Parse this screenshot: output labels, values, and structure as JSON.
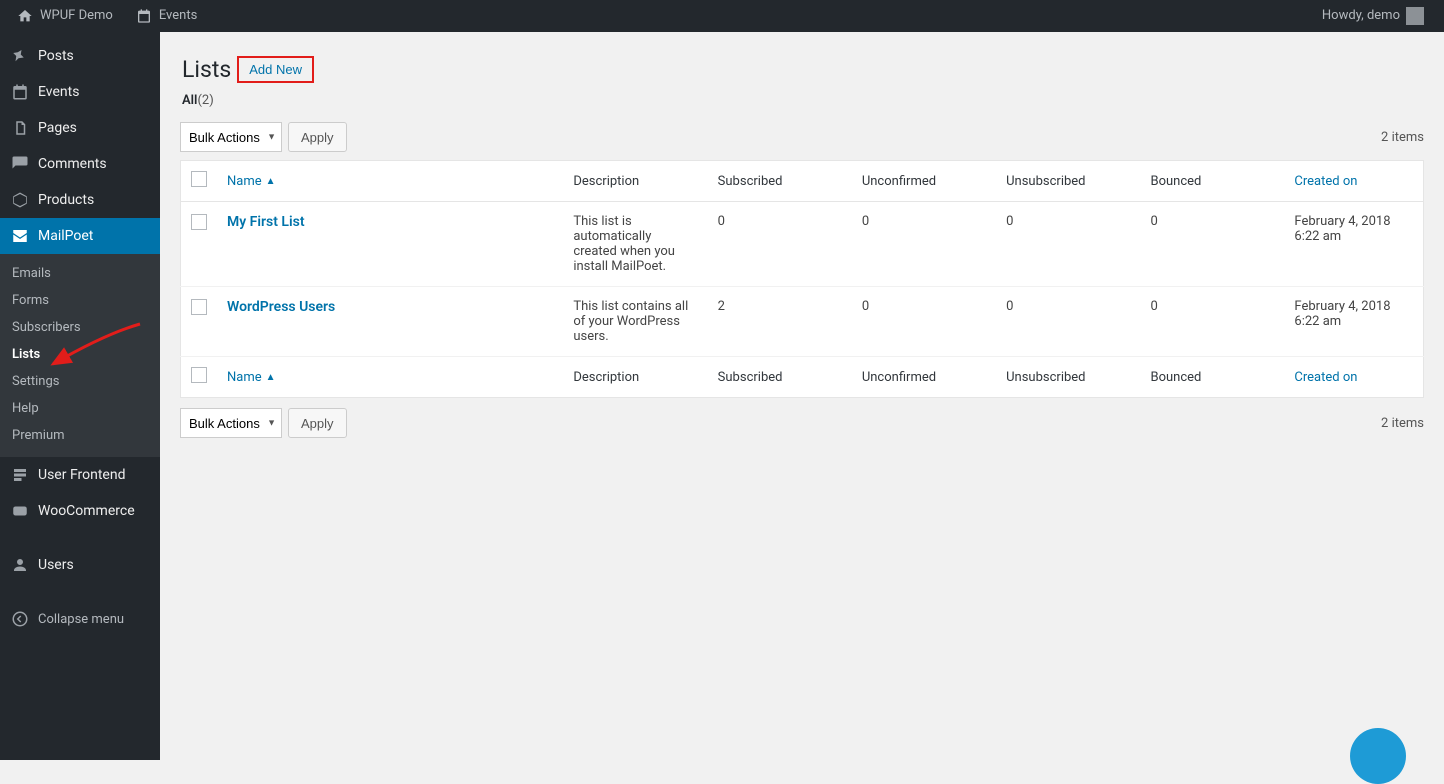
{
  "adminbar": {
    "site_name": "WPUF Demo",
    "events_label": "Events",
    "howdy": "Howdy, demo"
  },
  "sidebar": {
    "items": [
      {
        "label": "Posts"
      },
      {
        "label": "Events"
      },
      {
        "label": "Pages"
      },
      {
        "label": "Comments"
      },
      {
        "label": "Products"
      },
      {
        "label": "MailPoet"
      },
      {
        "label": "User Frontend"
      },
      {
        "label": "WooCommerce"
      },
      {
        "label": "Users"
      }
    ],
    "mailpoet_sub": [
      {
        "label": "Emails"
      },
      {
        "label": "Forms"
      },
      {
        "label": "Subscribers"
      },
      {
        "label": "Lists"
      },
      {
        "label": "Settings"
      },
      {
        "label": "Help"
      },
      {
        "label": "Premium"
      }
    ],
    "collapse_label": "Collapse menu"
  },
  "page": {
    "title": "Lists",
    "add_new_label": "Add New",
    "filter_all_label": "All",
    "filter_all_count": "(2)",
    "bulk_actions_label": "Bulk Actions",
    "apply_label": "Apply",
    "items_count_label": "2 items"
  },
  "columns": {
    "name": "Name",
    "description": "Description",
    "subscribed": "Subscribed",
    "unconfirmed": "Unconfirmed",
    "unsubscribed": "Unsubscribed",
    "bounced": "Bounced",
    "created_on": "Created on"
  },
  "rows": [
    {
      "name": "My First List",
      "description": "This list is automatically created when you install MailPoet.",
      "subscribed": "0",
      "unconfirmed": "0",
      "unsubscribed": "0",
      "bounced": "0",
      "created_on": "February 4, 2018 6:22 am"
    },
    {
      "name": "WordPress Users",
      "description": "This list contains all of your WordPress users.",
      "subscribed": "2",
      "unconfirmed": "0",
      "unsubscribed": "0",
      "bounced": "0",
      "created_on": "February 4, 2018 6:22 am"
    }
  ]
}
